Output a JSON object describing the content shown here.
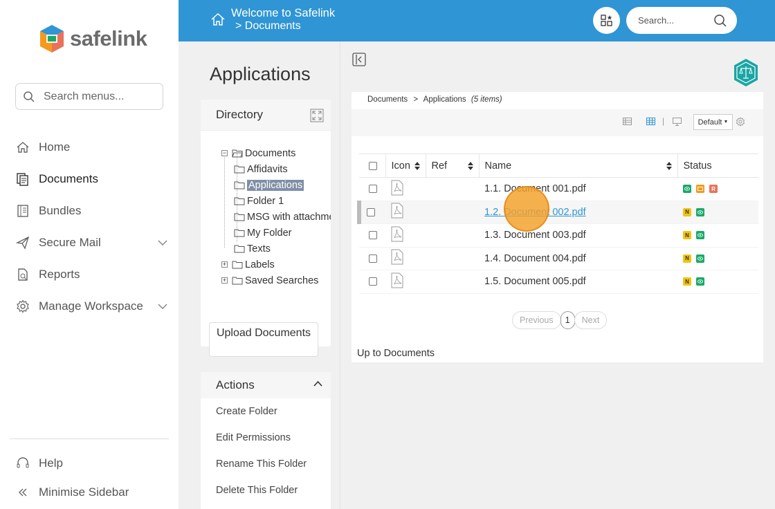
{
  "app": {
    "brand": "safelink"
  },
  "sidebar": {
    "search_placeholder": "Search menus...",
    "items": [
      {
        "label": "Home",
        "icon": "home-icon"
      },
      {
        "label": "Documents",
        "icon": "documents-icon"
      },
      {
        "label": "Bundles",
        "icon": "bundles-icon"
      },
      {
        "label": "Secure Mail",
        "icon": "send-icon"
      },
      {
        "label": "Reports",
        "icon": "report-icon"
      },
      {
        "label": "Manage Workspace",
        "icon": "gear-icon"
      }
    ],
    "help_label": "Help",
    "minimise_label": "Minimise Sidebar"
  },
  "topbar": {
    "title": "Welcome to Safelink",
    "crumb": "> Documents",
    "search_placeholder": "Search...",
    "color": "#2f95d4"
  },
  "panel": {
    "title": "Applications",
    "directory_label": "Directory",
    "tree": {
      "root": "Documents",
      "children": [
        "Affidavits",
        "Applications",
        "Folder 1",
        "MSG with attachment",
        "My Folder",
        "Texts"
      ],
      "selected": "Applications",
      "others": [
        "Labels",
        "Saved Searches"
      ]
    },
    "upload_label": "Upload Documents",
    "actions_label": "Actions",
    "actions": [
      "Create Folder",
      "Edit Permissions",
      "Rename This Folder",
      "Delete This Folder"
    ]
  },
  "main": {
    "breadcrumb": {
      "root": "Documents",
      "sep": ">",
      "current": "Applications",
      "count": "(5 items)"
    },
    "view_select": "Default",
    "columns": {
      "icon": "Icon",
      "ref": "Ref",
      "name": "Name",
      "status": "Status"
    },
    "rows": [
      {
        "name": "1.1. Document 001.pdf",
        "status": [
          "eye",
          "msg",
          "R"
        ]
      },
      {
        "name": "1.2. Document 002.pdf",
        "status": [
          "N",
          "eye"
        ]
      },
      {
        "name": "1.3. Document 003.pdf",
        "status": [
          "N",
          "eye"
        ]
      },
      {
        "name": "1.4. Document 004.pdf",
        "status": [
          "N",
          "eye"
        ]
      },
      {
        "name": "1.5. Document 005.pdf",
        "status": [
          "N",
          "eye"
        ]
      }
    ],
    "pager": {
      "prev": "Previous",
      "page": "1",
      "next": "Next"
    },
    "up_label": "Up to Documents"
  },
  "colors": {
    "accent": "#2f95d4",
    "status_green": "#1aa86a",
    "status_yellow": "#f2c40f",
    "status_orange": "#f39a1e",
    "status_red": "#e8735a",
    "badge_teal": "#1aa5a5"
  }
}
